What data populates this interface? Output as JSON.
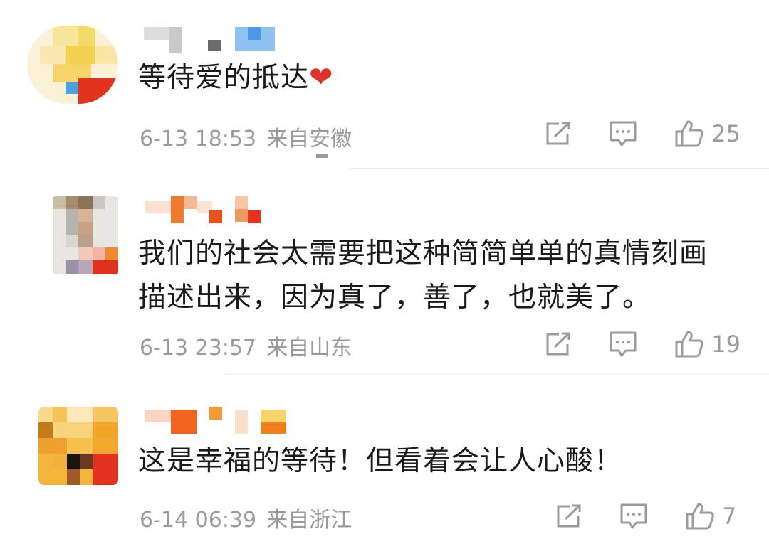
{
  "comments": [
    {
      "text": "等待爱的抵达",
      "heart": "❤",
      "date": "6-13 18:53",
      "location": "来自安徽",
      "likes": "25"
    },
    {
      "text_line1": "我们的社会太需要把这种简简单单的真情刻画",
      "text_line2": "描述出来，因为真了，善了，也就美了。",
      "date": "6-13 23:57",
      "location": "来自山东",
      "likes": "19"
    },
    {
      "text": "这是幸福的等待！但看着会让人心酸！",
      "date": "6-14 06:39",
      "location": "来自浙江",
      "likes": "7"
    }
  ],
  "icons": {
    "share": "share-icon",
    "reply": "comment-icon",
    "like": "thumbs-up-icon"
  },
  "colors": {
    "meta_text": "#9b9b9b",
    "heart": "#e0302a"
  }
}
